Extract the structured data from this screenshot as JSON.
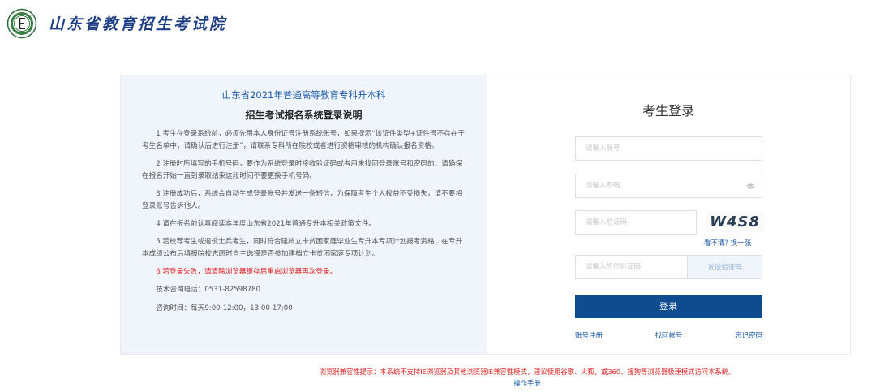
{
  "header": {
    "site_title": "山东省教育招生考试院"
  },
  "notice": {
    "title_line1": "山东省2021年普通高等教育专科升本科",
    "title_line2": "招生考试报名系统登录说明",
    "items": [
      "1 考生在登录系统前，必须先用本人身份证号注册系统账号，如果提示“该证件类型+证件号不存在于考生名单中，请确认后进行注册”，请联系专科所在院校或者进行资格审核的机构确认报名资格。",
      "2 注册时所填写的手机号码，要作为系统登录时接收验证码或者用来找回登录账号和密码的，请确保在报名开始一直到录取结束这段时间不要更换手机号码。",
      "3 注册成功后，系统会自动生成登录账号并发送一条短信，为保障考生个人权益不受损失，请不要将登录账号告诉他人。",
      "4 请在报名前认真阅读本年度山东省2021年普通专升本相关政策文件。",
      "5 若校荐考生或退役士兵考生，同时符合建档立卡贫困家庭毕业生专升本专项计划报考资格，在专升本成绩公布后填报院校志愿时自主选择是否参加建档立卡贫困家庭专项计划。"
    ],
    "warning": "6 若登录失败，请清除浏览器缓存后重启浏览器再次登录。",
    "phone": "技术咨询电话：0531-82598780",
    "hours": "咨询时间：每天9:00-12:00，13:00-17:00"
  },
  "login": {
    "title": "考生登录",
    "account_placeholder": "请输入账号",
    "password_placeholder": "请输入密码",
    "captcha_placeholder": "请输入验证码",
    "captcha_text": "W4S8",
    "refresh_prefix": "看不清?",
    "refresh_link": "换一张",
    "sms_placeholder": "请输入短信验证码",
    "sms_button": "发送验证码",
    "submit": "登录",
    "register": "账号注册",
    "recover_account": "找回帐号",
    "forgot_password": "忘记密码"
  },
  "footer": {
    "tip": "浏览器兼容性提示：本系统不支持IE浏览器及其他浏览器IE兼容性模式，建议使用谷歌、火狐，或360、搜狗等浏览器极速模式访问本系统。",
    "manual": "操作手册"
  },
  "colors": {
    "brand": "#1e3e86",
    "primary_button": "#0f4c8f",
    "link": "#1e5ba8",
    "warning": "#e02020",
    "notice_bg": "#f0f5fb"
  }
}
